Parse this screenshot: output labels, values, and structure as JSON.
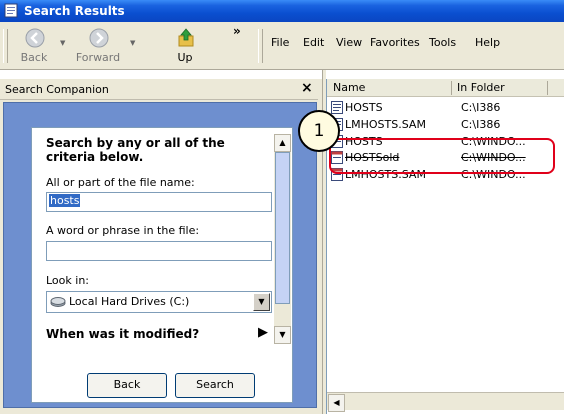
{
  "window": {
    "title": "Search Results"
  },
  "toolbar": {
    "back_label": "Back",
    "forward_label": "Forward",
    "up_label": "Up",
    "overflow": "»"
  },
  "menu": [
    "File",
    "Edit",
    "View",
    "Favorites",
    "Tools",
    "Help"
  ],
  "companion": {
    "title": "Search Companion",
    "close": "×",
    "heading": "Search by any or all of the criteria below.",
    "filename_label": "All or part of the file name:",
    "filename_value": "hosts",
    "phrase_label": "A word or phrase in the file:",
    "phrase_value": "",
    "lookin_label": "Look in:",
    "lookin_value": "Local Hard Drives (C:)",
    "modified_label": "When was it modified?",
    "back_button": "Back",
    "search_button": "Search"
  },
  "results": {
    "columns": [
      "Name",
      "In Folder"
    ],
    "rows": [
      {
        "name": "HOSTS",
        "folder": "C:\\I386"
      },
      {
        "name": "LMHOSTS.SAM",
        "folder": "C:\\I386"
      },
      {
        "name": "HOSTS",
        "folder": "C:\\WINDO..."
      },
      {
        "name": "HOSTSold",
        "folder": "C:\\WINDO..."
      },
      {
        "name": "LMHOSTS.SAM",
        "folder": "C:\\WINDO..."
      }
    ]
  },
  "callout": {
    "number": "1"
  },
  "colors": {
    "titlebar": "#0a4fd0",
    "highlight": "#e0001a",
    "companion_bg": "#6e8fcf"
  }
}
